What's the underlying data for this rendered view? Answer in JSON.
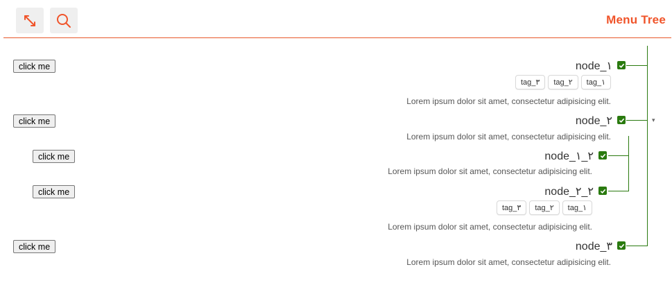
{
  "header": {
    "title": "Menu Tree",
    "expand_icon": "expand-arrows-icon",
    "search_icon": "search-icon",
    "accent": "#f0542a"
  },
  "tree_color": "#2a7a0f",
  "toggle_glyph": "▾",
  "nodes": [
    {
      "label": "node_١",
      "tags": [
        "tag_١",
        "tag_٢",
        "tag_٣"
      ],
      "description": "Lorem ipsum dolor sit amet, consectetur adipisicing elit.",
      "button": "click me",
      "checked": true
    },
    {
      "label": "node_٢",
      "tags": [],
      "description": "Lorem ipsum dolor sit amet, consectetur adipisicing elit.",
      "button": "click me",
      "checked": true,
      "children": [
        {
          "label": "node_٢_١",
          "tags": [],
          "description": "Lorem ipsum dolor sit amet, consectetur adipisicing elit.",
          "button": "click me",
          "checked": true
        },
        {
          "label": "node_٢_٢",
          "tags": [
            "tag_١",
            "tag_٢",
            "tag_٣"
          ],
          "description": "Lorem ipsum dolor sit amet, consectetur adipisicing elit.",
          "button": "click me",
          "checked": true
        }
      ]
    },
    {
      "label": "node_٣",
      "tags": [],
      "description": "Lorem ipsum dolor sit amet, consectetur adipisicing elit.",
      "button": "click me",
      "checked": true
    }
  ]
}
